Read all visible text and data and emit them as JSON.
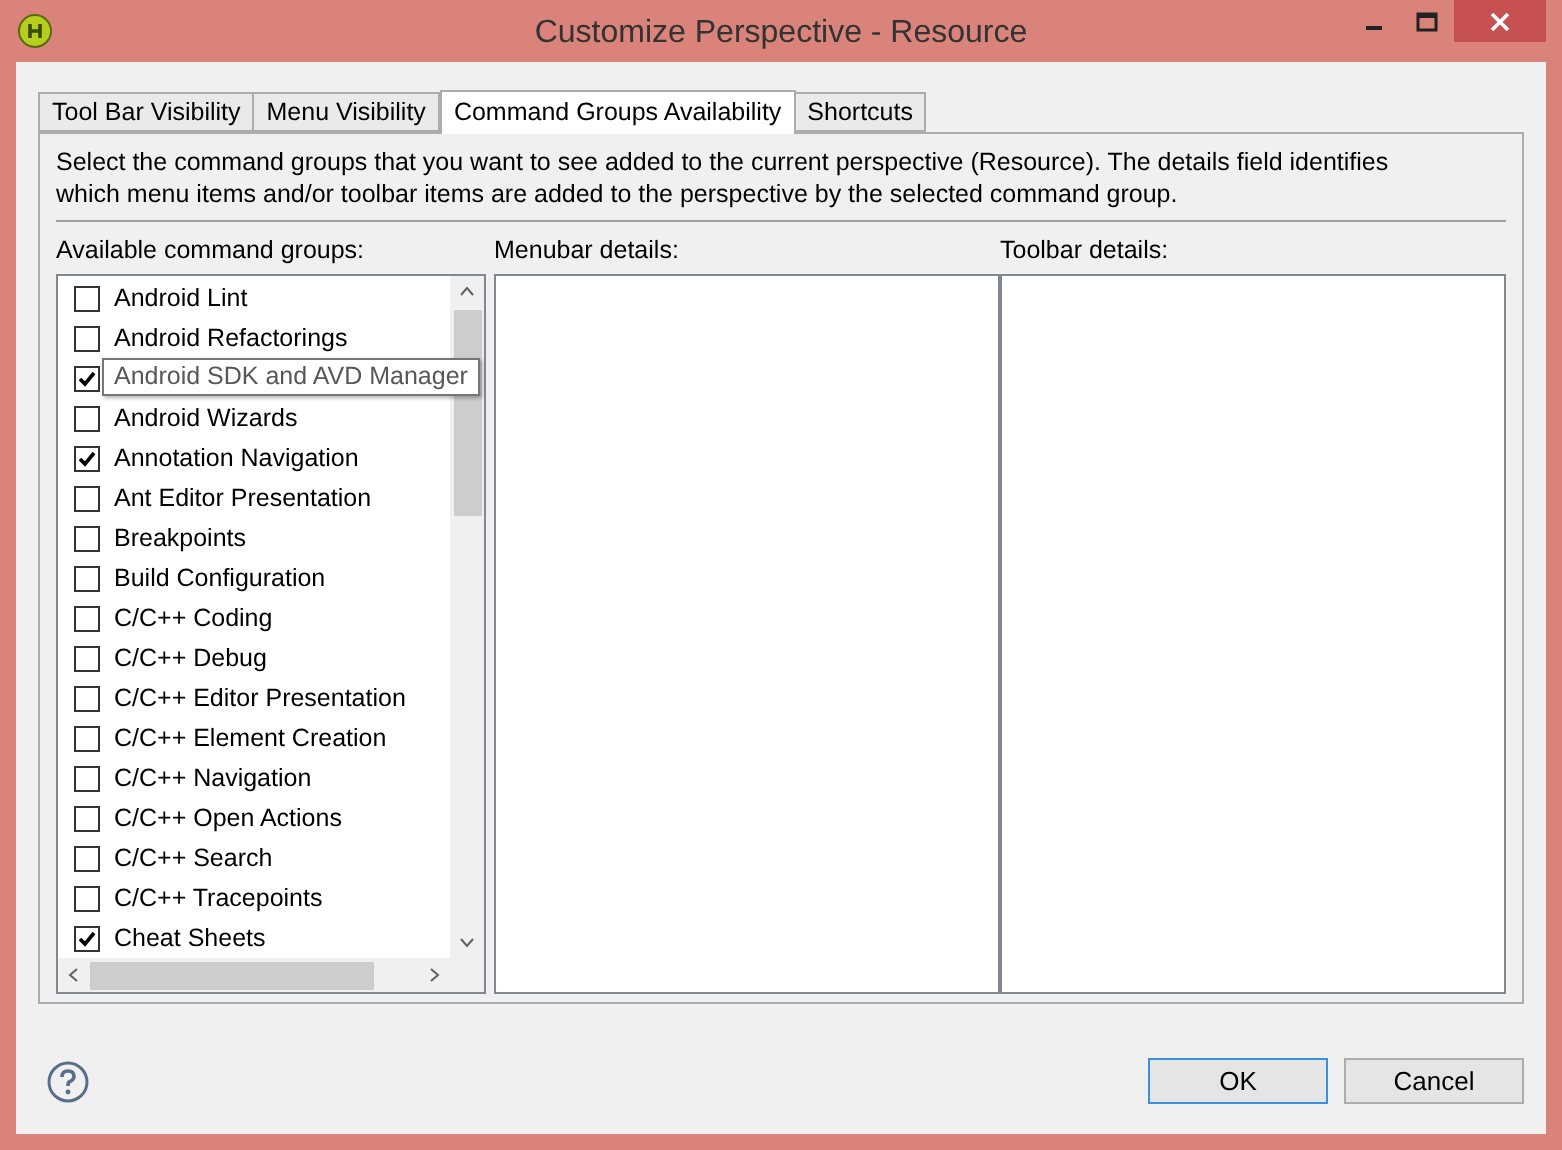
{
  "window": {
    "title": "Customize Perspective - Resource"
  },
  "tabs": [
    {
      "label": "Tool Bar Visibility",
      "selected": false
    },
    {
      "label": "Menu Visibility",
      "selected": false
    },
    {
      "label": "Command Groups Availability",
      "selected": true
    },
    {
      "label": "Shortcuts",
      "selected": false
    }
  ],
  "description": "Select the command groups that you want to see added to the current perspective (Resource).  The details field identifies which menu items and/or toolbar items are added to the perspective by the selected command group.",
  "columns": {
    "groups": "Available command groups:",
    "menubar": "Menubar details:",
    "toolbar": "Toolbar details:"
  },
  "command_groups": [
    {
      "label": "Android Lint",
      "checked": false,
      "tooltip": false
    },
    {
      "label": "Android Refactorings",
      "checked": false,
      "tooltip": false
    },
    {
      "label": "Android SDK and AVD Manager",
      "checked": true,
      "tooltip": true
    },
    {
      "label": "Android Wizards",
      "checked": false,
      "tooltip": false
    },
    {
      "label": "Annotation Navigation",
      "checked": true,
      "tooltip": false
    },
    {
      "label": "Ant Editor Presentation",
      "checked": false,
      "tooltip": false
    },
    {
      "label": "Breakpoints",
      "checked": false,
      "tooltip": false
    },
    {
      "label": "Build Configuration",
      "checked": false,
      "tooltip": false
    },
    {
      "label": "C/C++ Coding",
      "checked": false,
      "tooltip": false
    },
    {
      "label": "C/C++ Debug",
      "checked": false,
      "tooltip": false
    },
    {
      "label": "C/C++ Editor Presentation",
      "checked": false,
      "tooltip": false
    },
    {
      "label": "C/C++ Element Creation",
      "checked": false,
      "tooltip": false
    },
    {
      "label": "C/C++ Navigation",
      "checked": false,
      "tooltip": false
    },
    {
      "label": "C/C++ Open Actions",
      "checked": false,
      "tooltip": false
    },
    {
      "label": "C/C++ Search",
      "checked": false,
      "tooltip": false
    },
    {
      "label": "C/C++ Tracepoints",
      "checked": false,
      "tooltip": false
    },
    {
      "label": "Cheat Sheets",
      "checked": true,
      "tooltip": false
    }
  ],
  "buttons": [
    {
      "label": "OK",
      "default": true
    },
    {
      "label": "Cancel",
      "default": false
    }
  ]
}
